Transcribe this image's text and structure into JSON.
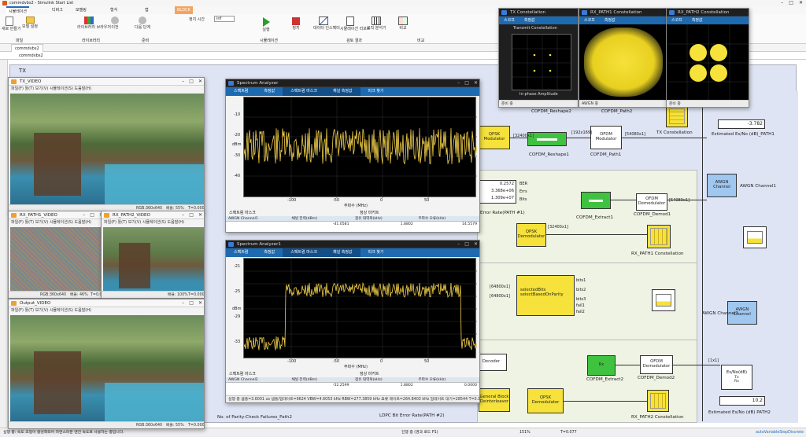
{
  "app": {
    "title": "commdvbs2 - Simulink Start List",
    "ribbon_tabs": [
      "시뮬레이션",
      "디버그",
      "모델링",
      "형식",
      "앱",
      "BLOCK"
    ],
    "ribbon_tools": [
      "새로 만들기",
      "모델 설정",
      "라이브러리 브라우저",
      "이전",
      "다음 단계",
      "정지 시간",
      "실행",
      "정지",
      "데이터 인스펙터",
      "시뮬레이션 리포트",
      "로직 분석기",
      "비교",
      "라이브러리 브라우저",
      "업데이트 모델",
      "새로 고침"
    ],
    "sections": [
      "파일",
      "라이브러리",
      "준비",
      "시뮬레이션",
      "검토 결과",
      "비교"
    ],
    "stop_time": "inf",
    "breadcrumb": "commdvbs2",
    "model_tab": "commdvbs2",
    "status": {
      "left": "실행 중: 속도 조정이 활성화되어 자연스러운 엔진 속도로 사용하는 중입니다.",
      "middle": "진행 중 (경과 로드 P1)",
      "zoom": "151%",
      "time": "T=0.077",
      "solver": "autoVariableStepDiscrete"
    }
  },
  "canvas": {
    "subsystem_label": "TX",
    "blocks": [
      {
        "id": "qpsk_mod",
        "label": "QPSK Modulator"
      },
      {
        "id": "ofdm_mod",
        "label": "OFDM Modulator"
      },
      {
        "id": "cofdm_path1",
        "label": "COFDM_Path1"
      },
      {
        "id": "cofdm_reshape1",
        "label": "COFDM_Reshape1"
      },
      {
        "id": "cofdm_reshape2",
        "label": "COFDM_Reshape2"
      },
      {
        "id": "cofdm_path2",
        "label": "COFDM_Path2"
      },
      {
        "id": "tx_const",
        "label": "TX Constellation"
      },
      {
        "id": "awgn1",
        "label": "AWGN Channel"
      },
      {
        "id": "awgn1_lbl",
        "label": "AWGN Channel1"
      },
      {
        "id": "awgn2",
        "label": "AWGN Channel"
      },
      {
        "id": "awgn2_lbl",
        "label": "AWGN Channel2"
      },
      {
        "id": "est_esno1",
        "label": "Estimated Es/No (dB)_PATH1"
      },
      {
        "id": "est_esno2",
        "label": "Estimated Es/No (dB) PATH2"
      },
      {
        "id": "ofdm_demod1",
        "label": "OFDM Demodulator"
      },
      {
        "id": "cofdm_demod1",
        "label": "COFDM_Demod1"
      },
      {
        "id": "cofdm_extract1",
        "label": "COFDM_Extract1"
      },
      {
        "id": "ofdm_demod2",
        "label": "OFDM Demodulator"
      },
      {
        "id": "cofdm_demod2",
        "label": "COFDM_Demod2"
      },
      {
        "id": "cofdm_extract2",
        "label": "COFDM_Extract2"
      },
      {
        "id": "qpsk_demod1",
        "label": "QPSK Demodulator"
      },
      {
        "id": "qpsk_demod2",
        "label": "QPSK Demodulator"
      },
      {
        "id": "rx_path1_const",
        "label": "RX_PATH1 Constellation"
      },
      {
        "id": "rx_path2_const",
        "label": "RX_PATH2 Constellation"
      },
      {
        "id": "selected",
        "label": "selectBasedOnParity"
      },
      {
        "id": "ber_label",
        "label": "Error Rate(PATH #1)"
      },
      {
        "id": "ldpc_label",
        "label": "LDPC Bit Error Rate(PATH #2)"
      },
      {
        "id": "parity_label",
        "label": "No. of Parity-Check Failures_Path2"
      },
      {
        "id": "decoder",
        "label": "Decoder"
      },
      {
        "id": "gen_block",
        "label": "General Block Deinterleaver"
      }
    ],
    "signals": [
      "[32400x1]",
      "[192x169]",
      "[54080x1]",
      "[64800x1]",
      "[1x1]",
      "[32400x1]",
      "[54080x1]",
      "[64800x1]"
    ],
    "displays": {
      "esno1": "-3.782",
      "esno2": "10.2",
      "ber1": "0.2572",
      "ber2": "3.368e+06",
      "ber3": "1.309e+07",
      "ber_labels": [
        "BER",
        "Errs",
        "Bits"
      ],
      "esno_block": "Es/No(dB)",
      "esno_in": "Tx",
      "esno_out": "Rx"
    },
    "port_labels": [
      "bits1",
      "bits2",
      "bits3",
      "fail1",
      "fail2"
    ],
    "selected_in": "selectedBits"
  },
  "video_windows": [
    {
      "title": "TX_VIDEO",
      "menu": "파일(F) 툴(T) 보기(V) 시뮬레이션(S) 도움말(H)",
      "status_left": "RGB:360x640",
      "status_mid": "배율: 55%",
      "status_right": "T=0.000"
    },
    {
      "title": "RX_PATH1_VIDEO",
      "menu": "파일(F) 툴(T) 보기(V) 시뮬레이션(S) 도움말(H)",
      "status_left": "RGB:360x640",
      "status_mid": "배율: 46%",
      "status_right": "T=0.000"
    },
    {
      "title": "RX_PATH2_VIDEO",
      "menu": "파일(F) 툴(T) 보기(V) 시뮬레이션(S) 도움말(H)",
      "status_left": "",
      "status_mid": "배율: 100%",
      "status_right": "T=0.000"
    },
    {
      "title": "Output_VIDEO",
      "menu": "파일(F) 툴(T) 보기(V) 시뮬레이션(S) 도움말(H)",
      "status_left": "RGB:360x640",
      "status_mid": "배율: 55%",
      "status_right": "T=0.000"
    }
  ],
  "spectrum": [
    {
      "title": "Spectrum Analyzer",
      "toolbar": [
        "스펙트럼",
        "측정값",
        "스펙트럼 마스크",
        "채널 측정값",
        "피크 찾기"
      ],
      "xlabel": "주파수 (MHz)",
      "ylabel": "dBm",
      "legend_title": "스펙트럼 마스크",
      "legend_title2": "정상 마커트",
      "table_header": [
        "AWGN Channel1",
        "채널 전력(dBm)",
        "점유 대역폭(kHz)",
        "주파수 오류(kHz)"
      ],
      "table_row": [
        "",
        "-41.0581",
        "1.8802",
        "14.5579"
      ],
      "yticks": [
        "-10",
        "-20",
        "-30",
        "-40",
        "-50"
      ],
      "xticks": [
        "-100",
        "-50",
        "0",
        "50",
        "100"
      ]
    },
    {
      "title": "Spectrum Analyzer1",
      "toolbar": [
        "스펙트럼",
        "측정값",
        "스펙트럼 마스크",
        "채널 측정값",
        "피크 찾기"
      ],
      "xlabel": "주파수 (MHz)",
      "ylabel": "dBm",
      "legend_title": "스펙트럼 마스크",
      "legend_title2": "정상 마커트",
      "table_header": [
        "AWGN Channel2",
        "채널 전력(dBm)",
        "점유 대역폭(kHz)",
        "주파수 오류(kHz)"
      ],
      "table_row": [
        "",
        "-52.2599",
        "1.8802",
        "0.0000"
      ],
      "yticks": [
        "-21",
        "-22",
        "-23",
        "-24",
        "-25",
        "-26",
        "-27",
        "-28",
        "-29",
        "-30",
        "-31",
        "-32",
        "-33",
        "-34",
        "-35",
        "-36"
      ],
      "xticks": [
        "-100",
        "-50",
        "0",
        "50",
        "100"
      ],
      "status": "실행 중    샘플=3.6001 us  샘플/업데이트=9624  VBW=4.6053 kHz  RBW=277.3859 kHz  표류 레이트=264.8403 kHz  업데이트 대기=28544  T=0.1"
    }
  ],
  "constellations": [
    {
      "title": "TX Constellation",
      "toolbar": [
        "스코프",
        "측정값"
      ],
      "plot_title": "Transmit Constellation",
      "xlabel": "In-phase Amplitude",
      "ylabel": "Quadrature Amplitude",
      "status": "준비 중"
    },
    {
      "title": "RX_PATH1 Constellation",
      "toolbar": [
        "스코프",
        "측정값"
      ],
      "status": "AWGN 중"
    },
    {
      "title": "RX_PATH2 Constellation",
      "toolbar": [
        "스코프",
        "측정값"
      ],
      "status": "준비 중"
    }
  ]
}
